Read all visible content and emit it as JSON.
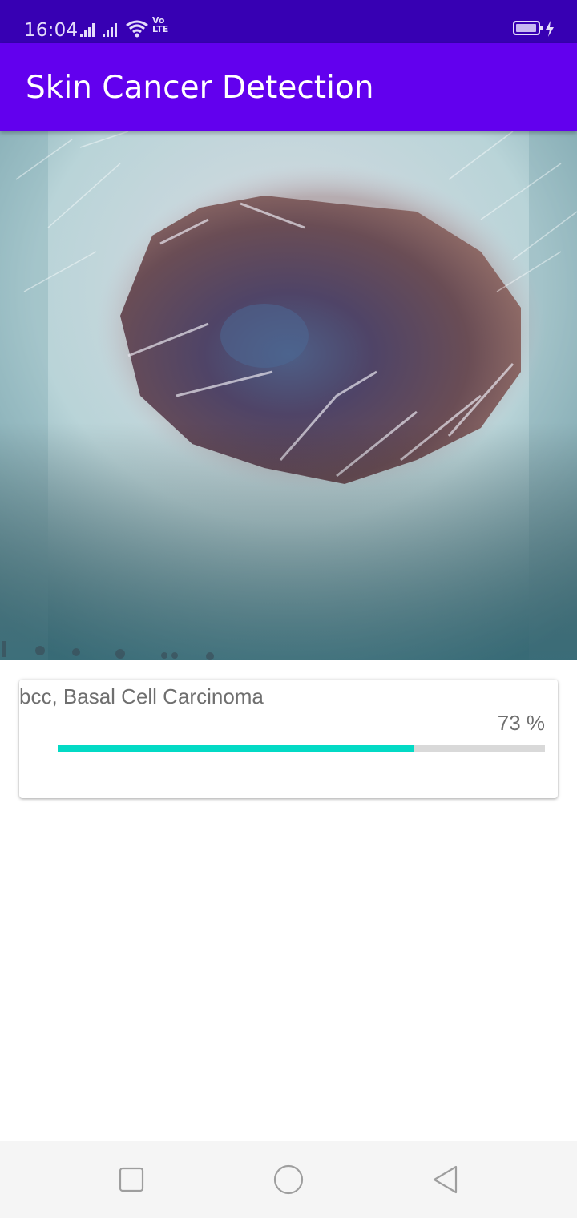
{
  "status_bar": {
    "time": "16:04",
    "volte_top": "Vo",
    "volte_bottom": "LTE",
    "icons": [
      "signal-icon",
      "signal-icon",
      "wifi-icon",
      "volte-icon",
      "battery-icon",
      "charging-icon"
    ]
  },
  "app_bar": {
    "title": "Skin Cancer Detection",
    "color": "#6200ee",
    "status_color": "#3700b3"
  },
  "result": {
    "label": "bcc, Basal Cell Carcinoma",
    "percent_text": "73 %",
    "progress": 0.73,
    "progress_color": "#03dac5"
  },
  "nav_bar": {
    "buttons": [
      "recents-square-icon",
      "home-circle-icon",
      "back-triangle-icon"
    ]
  }
}
